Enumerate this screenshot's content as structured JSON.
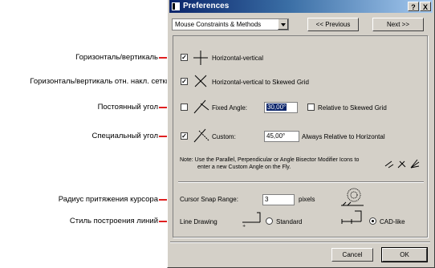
{
  "annotations": [
    "Горизонталь/вертикаль",
    "Горизонталь/вертикаль отн. накл. сетки",
    "Постоянный угол",
    "Специальный угол",
    "Радиус притяжения курсора",
    "Стиль построения линий"
  ],
  "window": {
    "title": "Preferences",
    "help_label": "?",
    "close_label": "X"
  },
  "toolbar": {
    "category": "Mouse Constraints & Methods",
    "previous_label": "<< Previous",
    "next_label": "Next >>"
  },
  "options": {
    "horizontal_vertical": {
      "label": "Horizontal-vertical",
      "checked": true
    },
    "skewed_grid": {
      "label": "Horizontal-vertical to Skewed Grid",
      "checked": true
    },
    "fixed_angle": {
      "label": "Fixed Angle:",
      "checked": false,
      "value": "30,00°",
      "relative_label": "Relative to Skewed Grid",
      "relative_checked": false
    },
    "custom": {
      "label": "Custom:",
      "checked": true,
      "value": "45,00°",
      "note": "Always Relative to Horizontal"
    }
  },
  "note": {
    "line1": "Note:  Use the Parallel, Perpendicular or Angle Bisector Modifier Icons to",
    "line2": "enter a new Custom Angle on the Fly."
  },
  "snap": {
    "label": "Cursor Snap Range:",
    "value": "3",
    "unit": "pixels"
  },
  "line_drawing": {
    "label": "Line Drawing",
    "standard_label": "Standard",
    "cadlike_label": "CAD-like",
    "selected": "CAD-like"
  },
  "footer": {
    "cancel_label": "Cancel",
    "ok_label": "OK"
  },
  "colors": {
    "arrow": "#e02020",
    "dialog_bg": "#d4d0c8",
    "title_bar": "#0a246a"
  }
}
